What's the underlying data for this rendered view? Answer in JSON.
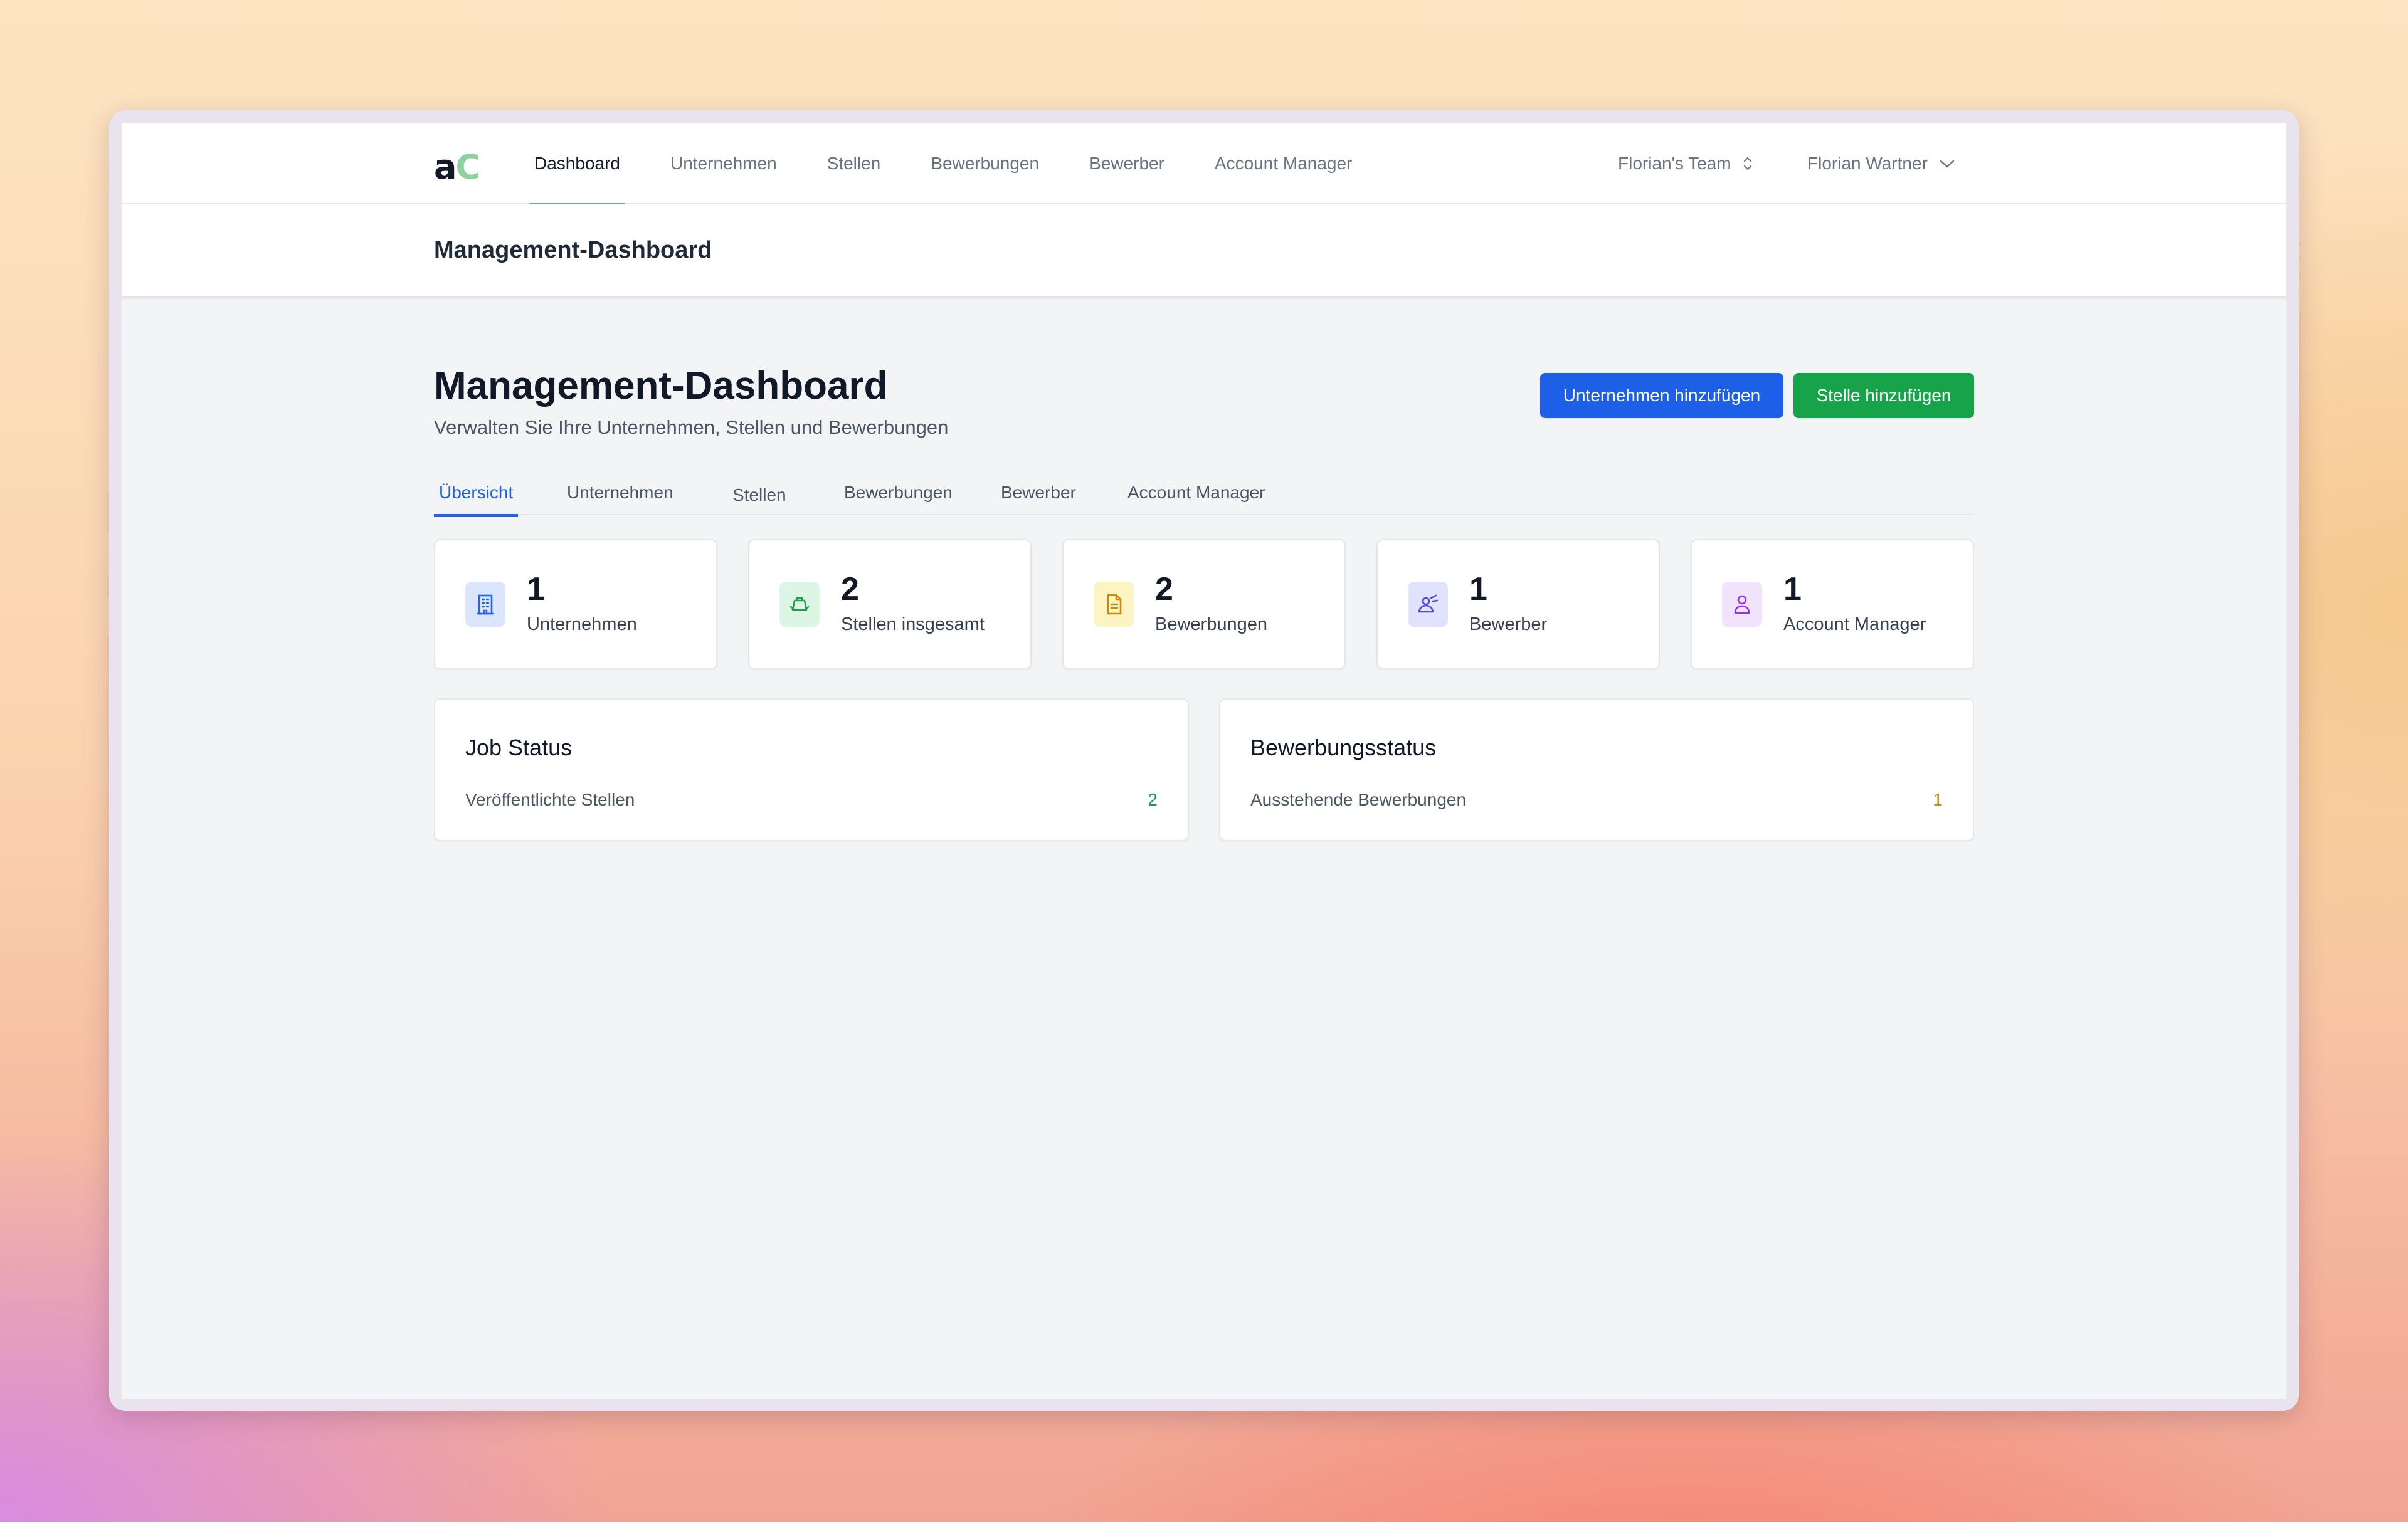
{
  "app": {
    "logo_a": "a",
    "logo_c": "C"
  },
  "nav": {
    "links": [
      "Dashboard",
      "Unternehmen",
      "Stellen",
      "Bewerbungen",
      "Bewerber",
      "Account Manager"
    ],
    "active": "Dashboard",
    "team": "Florian's Team",
    "user": "Florian Wartner"
  },
  "page_header": {
    "title": "Management-Dashboard"
  },
  "main": {
    "title": "Management-Dashboard",
    "subtitle": "Verwalten Sie Ihre Unternehmen, Stellen und Bewerbungen",
    "add_company_label": "Unternehmen hinzufügen",
    "add_job_label": "Stelle hinzufügen"
  },
  "tabs": [
    "Übersicht",
    "Unternehmen",
    "Stellen",
    "Bewerbungen",
    "Bewerber",
    "Account Manager"
  ],
  "stats": [
    {
      "value": "1",
      "label": "Unternehmen",
      "icon": "building-icon",
      "color": "#2563eb",
      "bg": "#dbe5fb"
    },
    {
      "value": "2",
      "label": "Stellen insgesamt",
      "icon": "briefcase-icon",
      "color": "#16a34a",
      "bg": "#dcf5e4"
    },
    {
      "value": "2",
      "label": "Bewerbungen",
      "icon": "document-icon",
      "color": "#ca8a04",
      "bg": "#fdf4c4"
    },
    {
      "value": "1",
      "label": "Bewerber",
      "icon": "applicant-icon",
      "color": "#4f46e5",
      "bg": "#e0e3fb"
    },
    {
      "value": "1",
      "label": "Account Manager",
      "icon": "user-icon",
      "color": "#9333ea",
      "bg": "#f1e3fb"
    }
  ],
  "job_status": {
    "title": "Job Status",
    "label": "Veröffentlichte Stellen",
    "value": "2",
    "value_color": "#16a34a"
  },
  "application_status": {
    "title": "Bewerbungsstatus",
    "label": "Ausstehende Bewerbungen",
    "value": "1",
    "value_color": "#ca8a04"
  }
}
